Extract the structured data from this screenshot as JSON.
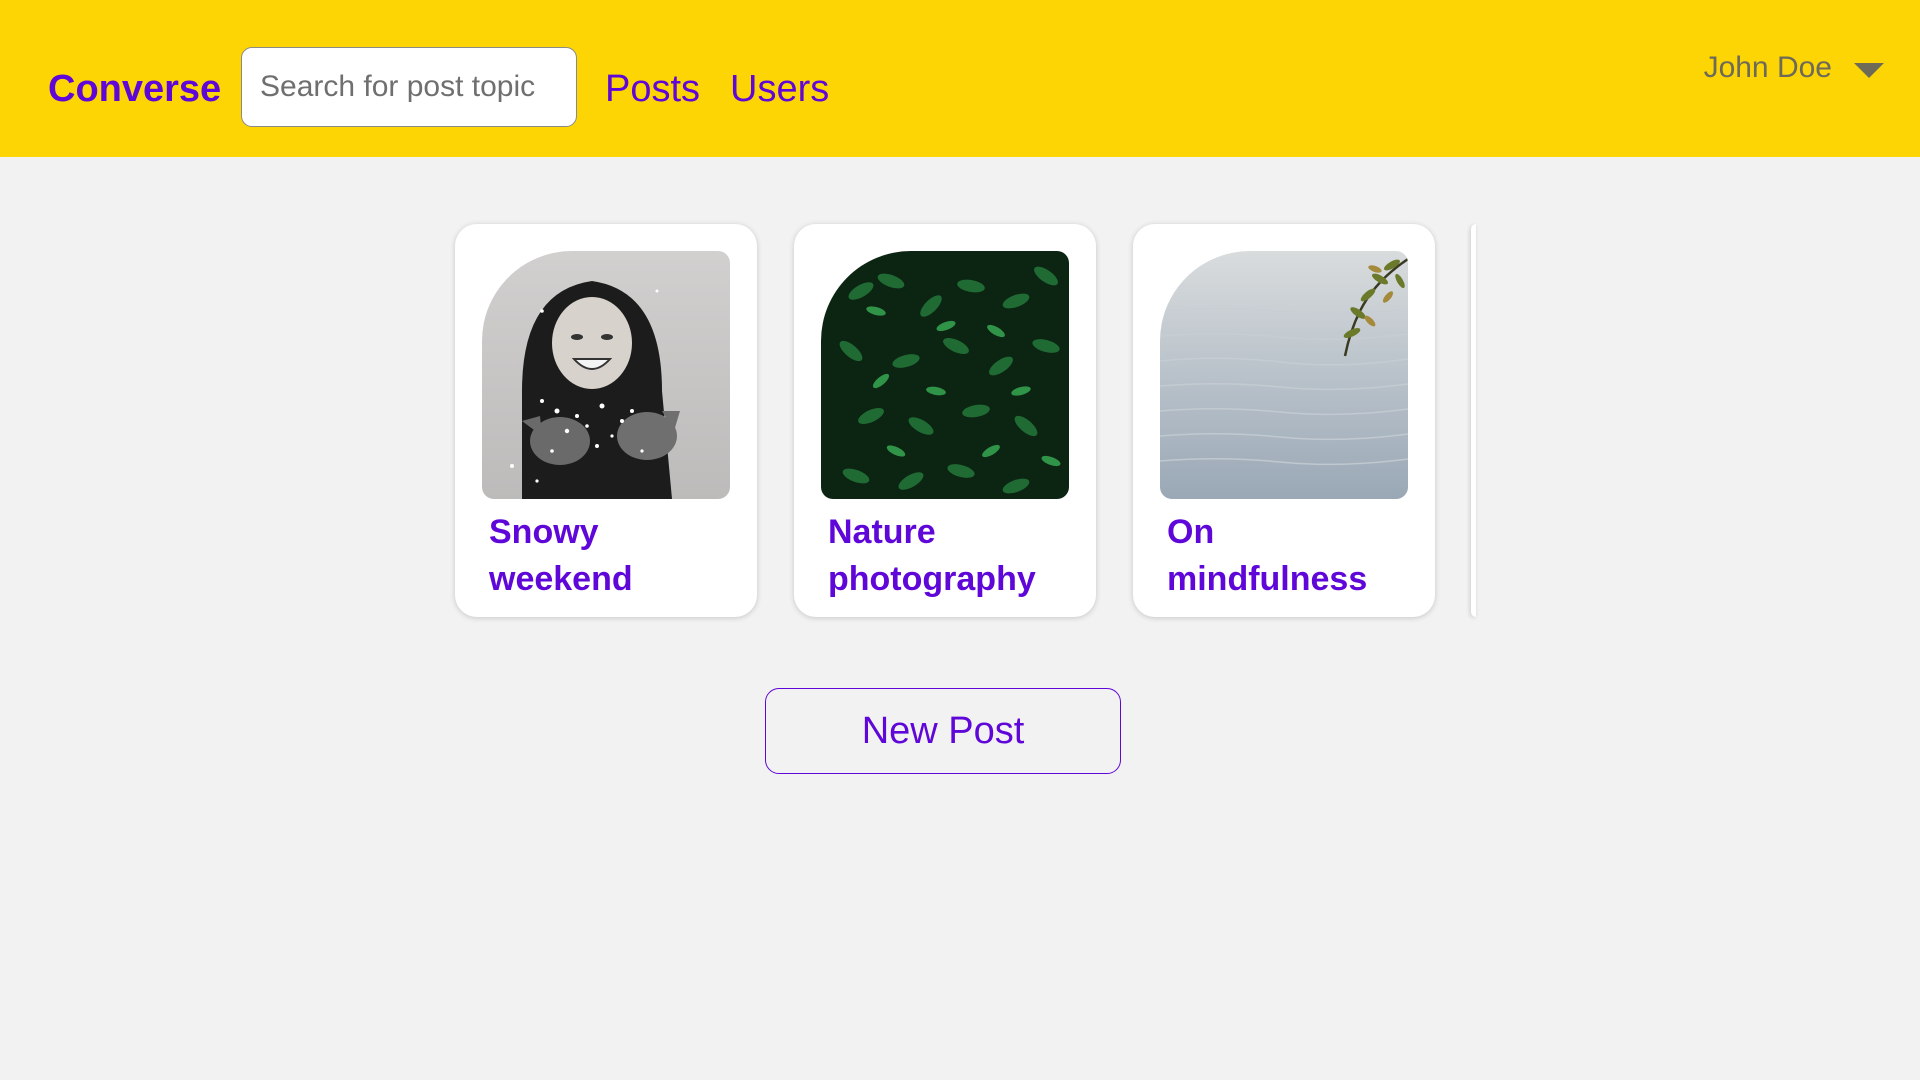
{
  "header": {
    "brand": "Converse",
    "search": {
      "placeholder": "Search for post topic",
      "value": ""
    },
    "nav": {
      "posts": "Posts",
      "users": "Users"
    },
    "user": {
      "name": "John Doe"
    }
  },
  "cards": [
    {
      "title": "Snowy weekend",
      "image_icon": "snow-portrait-photo"
    },
    {
      "title": "Nature photography",
      "image_icon": "fern-leaves-photo"
    },
    {
      "title": "On mindfulness",
      "image_icon": "lake-water-photo"
    }
  ],
  "actions": {
    "new_post": "New Post"
  },
  "colors": {
    "header_bg": "#fdd505",
    "accent": "#5f06d8",
    "page_bg": "#f2f2f2",
    "card_bg": "#ffffff"
  }
}
